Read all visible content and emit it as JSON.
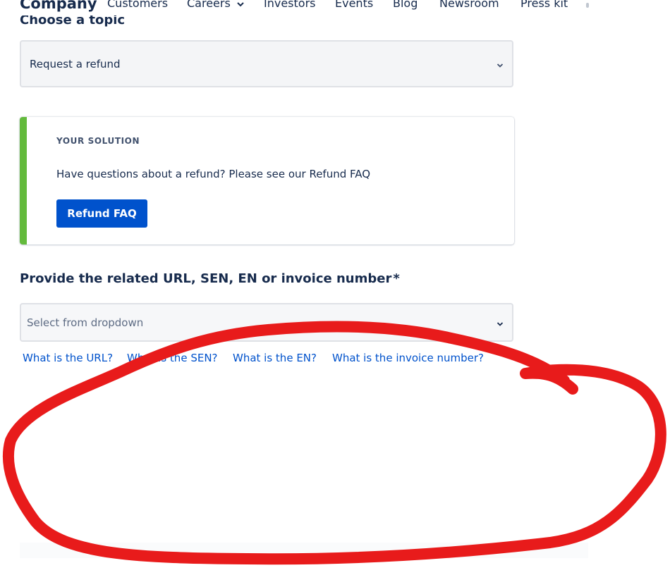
{
  "nav": {
    "brand": "Company",
    "items": [
      {
        "label": "Customers"
      },
      {
        "label": "Careers"
      },
      {
        "label": "Investors"
      },
      {
        "label": "Events"
      },
      {
        "label": "Blog"
      },
      {
        "label": "Newsroom"
      },
      {
        "label": "Press kit"
      }
    ],
    "careers_icon": "chevron-down-icon"
  },
  "topic": {
    "heading": "Choose a topic",
    "selected": "Request a refund",
    "icon": "chevron-down-icon"
  },
  "solution": {
    "eyebrow": "YOUR SOLUTION",
    "message": "Have questions about a refund? Please see our Refund FAQ",
    "button_label": "Refund FAQ",
    "accent_color": "#63ba3c",
    "button_color": "#0052cc"
  },
  "related": {
    "label": "Provide the related URL, SEN, EN or invoice number",
    "required_mark": "*",
    "placeholder": "Select from dropdown",
    "icon": "chevron-down-icon"
  },
  "help_links": [
    {
      "label": "What is the URL?"
    },
    {
      "label": "What is the SEN?"
    },
    {
      "label": "What is the EN?"
    },
    {
      "label": "What is the invoice number?"
    }
  ],
  "annotation": {
    "shape": "freehand-circle",
    "color": "#e81b1b"
  }
}
